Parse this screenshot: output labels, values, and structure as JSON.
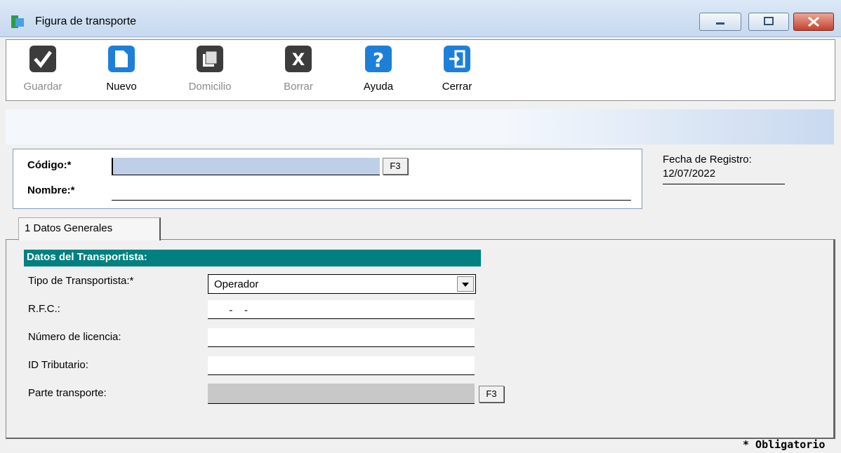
{
  "window": {
    "title": "Figura de transporte"
  },
  "toolbar": {
    "buttons": [
      {
        "label": "Guardar",
        "icon": "check-icon",
        "enabled": false
      },
      {
        "label": "Nuevo",
        "icon": "new-document-icon",
        "enabled": true
      },
      {
        "label": "Domicilio",
        "icon": "address-book-icon",
        "enabled": false
      },
      {
        "label": "Borrar",
        "icon": "delete-x-icon",
        "enabled": false
      },
      {
        "label": "Ayuda",
        "icon": "help-icon",
        "enabled": true
      },
      {
        "label": "Cerrar",
        "icon": "exit-door-icon",
        "enabled": true
      }
    ]
  },
  "header": {
    "codigo_label": "Código:*",
    "codigo_value": "",
    "nombre_label": "Nombre:*",
    "nombre_value": "",
    "f3_label": "F3",
    "fecha_label": "Fecha de Registro:",
    "fecha_value": "12/07/2022"
  },
  "tabs": [
    {
      "label": "1 Datos Generales",
      "active": true
    }
  ],
  "section": {
    "title": "Datos del Transportista:",
    "fields": {
      "tipo_label": "Tipo de Transportista:*",
      "tipo_value": "Operador",
      "rfc_label": "R.F.C.:",
      "rfc_value": "  -    -",
      "licencia_label": "Número de licencia:",
      "tributario_label": "ID Tributario:",
      "parte_label": "Parte transporte:",
      "parte_f3": "F3"
    }
  },
  "footer": {
    "obligatorio": "* Obligatorio"
  },
  "colors": {
    "section_header": "#008080",
    "codigo_field": "#c0cfe8",
    "disabled_text": "#8a8a8a"
  }
}
